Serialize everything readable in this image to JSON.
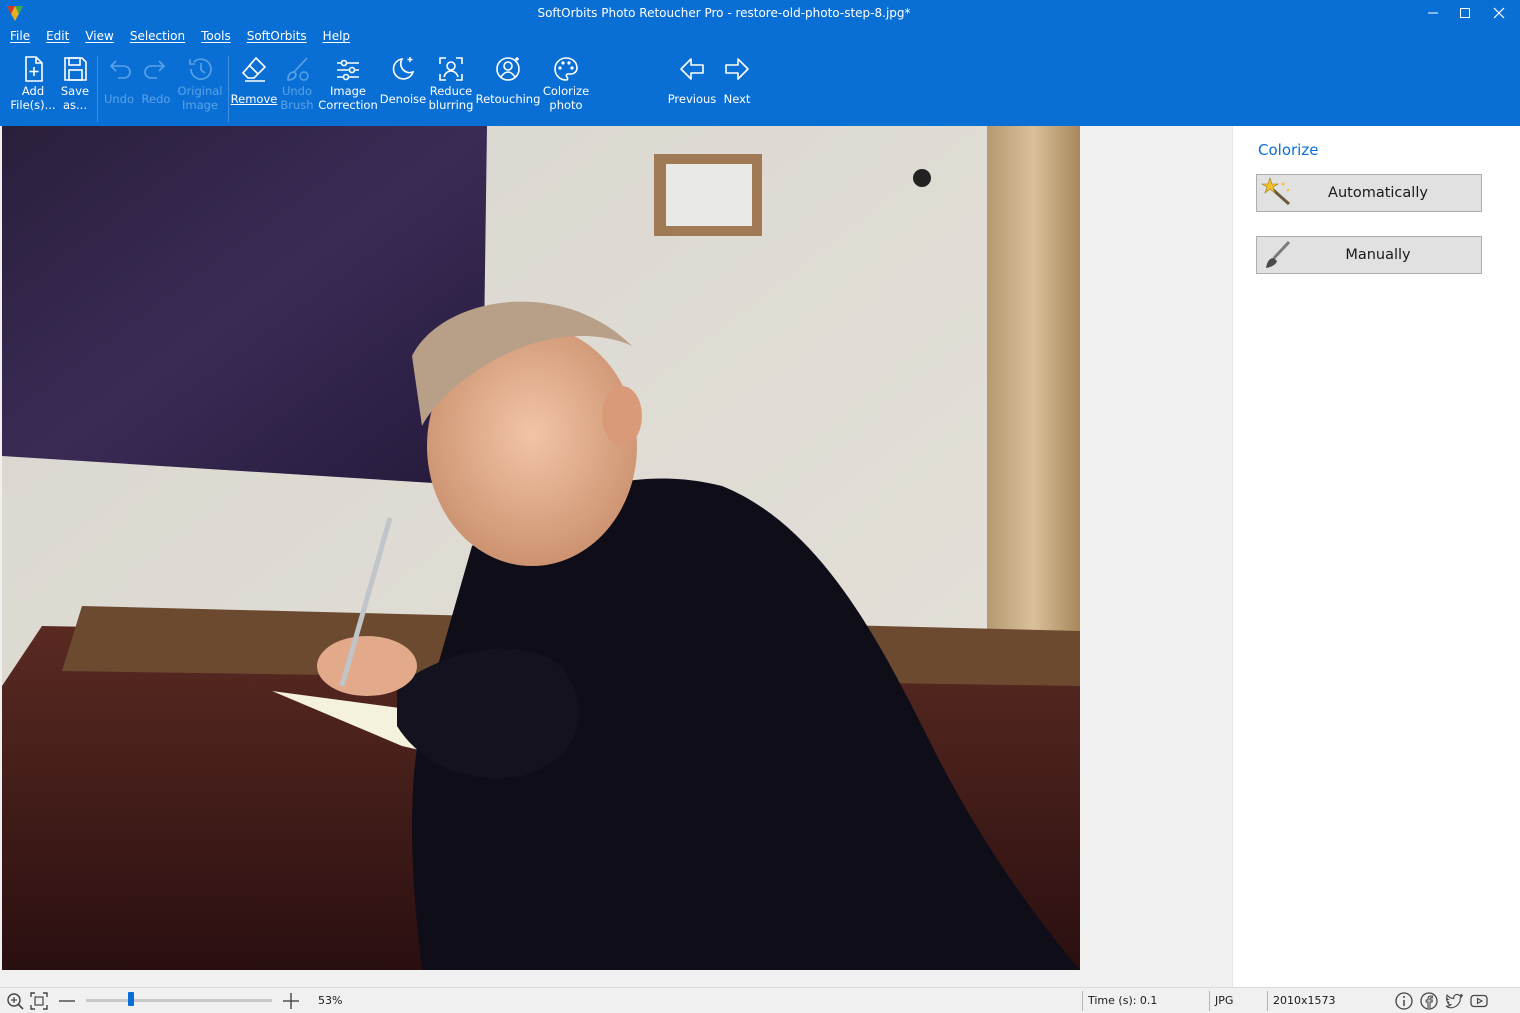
{
  "window": {
    "title": "SoftOrbits Photo Retoucher Pro - restore-old-photo-step-8.jpg*"
  },
  "menu": [
    "File",
    "Edit",
    "View",
    "Selection",
    "Tools",
    "SoftOrbits",
    "Help"
  ],
  "toolbar": {
    "add_files": "Add\nFile(s)...",
    "save_as": "Save\nas...",
    "undo": "Undo",
    "redo": "Redo",
    "original_image": "Original\nImage",
    "remove": "Remove",
    "undo_brush": "Undo\nBrush",
    "image_correction": "Image\nCorrection",
    "denoise": "Denoise",
    "reduce_blurring": "Reduce\nblurring",
    "retouching": "Retouching",
    "colorize_photo": "Colorize\nphoto",
    "previous": "Previous",
    "next": "Next"
  },
  "panel": {
    "title": "Colorize",
    "automatically": "Automatically",
    "manually": "Manually"
  },
  "status": {
    "zoom": "53%",
    "zoom_fraction": 0.24,
    "time": "Time (s): 0.1",
    "format": "JPG",
    "dimensions": "2010x1573"
  },
  "colors": {
    "accent": "#0a6fd4",
    "disabled": "#5aa3e6"
  }
}
